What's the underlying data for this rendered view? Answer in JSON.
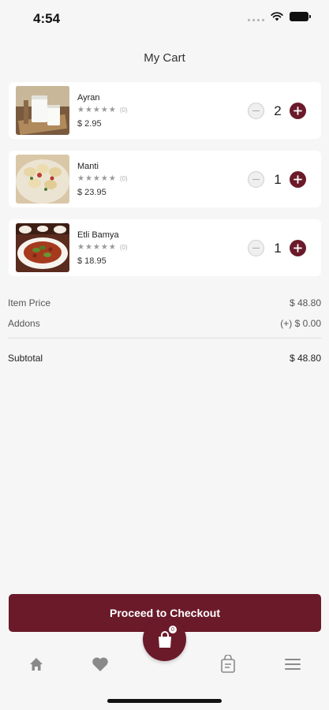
{
  "status_bar": {
    "time": "4:54"
  },
  "header": {
    "title": "My Cart"
  },
  "cart": {
    "items": [
      {
        "name": "Ayran",
        "stars": "★★★★★",
        "reviews": "(0)",
        "price": "$ 2.95",
        "quantity": "2",
        "image_icon": "ayran-drink-image"
      },
      {
        "name": "Manti",
        "stars": "★★★★★",
        "reviews": "(0)",
        "price": "$ 23.95",
        "quantity": "1",
        "image_icon": "manti-dumplings-image"
      },
      {
        "name": "Etli Bamya",
        "stars": "★★★★★",
        "reviews": "(0)",
        "price": "$ 18.95",
        "quantity": "1",
        "image_icon": "etli-bamya-stew-image"
      }
    ]
  },
  "summary": {
    "item_price_label": "Item Price",
    "item_price_value": "$ 48.80",
    "addons_label": "Addons",
    "addons_value": "(+) $ 0.00",
    "subtotal_label": "Subtotal",
    "subtotal_value": "$ 48.80"
  },
  "checkout": {
    "label": "Proceed to Checkout"
  },
  "nav": {
    "cart_badge": "0",
    "items": [
      "home-icon",
      "heart-icon",
      "cart-bag-icon",
      "orders-icon",
      "menu-icon"
    ]
  },
  "colors": {
    "accent": "#6b1a2a",
    "background": "#f6f6f6",
    "card": "#ffffff"
  }
}
